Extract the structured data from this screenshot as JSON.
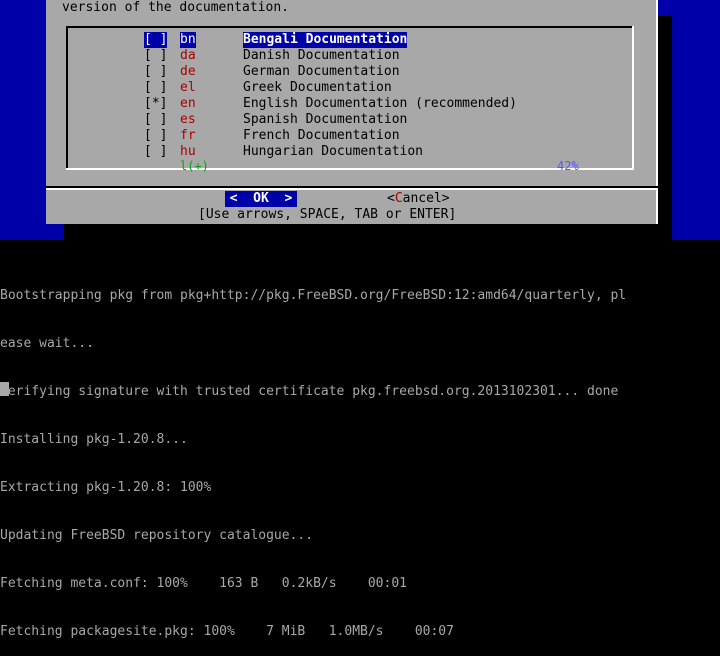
{
  "dialog": {
    "intro_text": "version of the documentation.",
    "items": [
      {
        "checkbox": "[ ]",
        "code": "bn",
        "label": "Bengali Documentation",
        "selected": true
      },
      {
        "checkbox": "[ ]",
        "code": "da",
        "label": "Danish Documentation",
        "selected": false
      },
      {
        "checkbox": "[ ]",
        "code": "de",
        "label": "German Documentation",
        "selected": false
      },
      {
        "checkbox": "[ ]",
        "code": "el",
        "label": "Greek Documentation",
        "selected": false
      },
      {
        "checkbox": "[*]",
        "code": "en",
        "label": "English Documentation (recommended)",
        "selected": false
      },
      {
        "checkbox": "[ ]",
        "code": "es",
        "label": "Spanish Documentation",
        "selected": false
      },
      {
        "checkbox": "[ ]",
        "code": "fr",
        "label": "French Documentation",
        "selected": false
      },
      {
        "checkbox": "[ ]",
        "code": "hu",
        "label": "Hungarian Documentation",
        "selected": false
      }
    ],
    "more_indicator": "l(+)",
    "percent": "42%",
    "ok_label": "<  OK  >",
    "cancel_prefix": "<",
    "cancel_hot": "C",
    "cancel_rest": "ancel>",
    "hint": "[Use arrows, SPACE, TAB or ENTER]"
  },
  "console": {
    "lines": [
      "Bootstrapping pkg from pkg+http://pkg.FreeBSD.org/FreeBSD:12:amd64/quarterly, pl",
      "ease wait...",
      "Verifying signature with trusted certificate pkg.freebsd.org.2013102301... done",
      "Installing pkg-1.20.8...",
      "Extracting pkg-1.20.8: 100%",
      "Updating FreeBSD repository catalogue...",
      "Fetching meta.conf: 100%    163 B   0.2kB/s    00:01",
      "Fetching packagesite.pkg: 100%    7 MiB   1.0MB/s    00:07"
    ]
  },
  "colors": {
    "background_blue": "#0000a8",
    "dialog_gray": "#a8a8a8",
    "selection_blue": "#0000a8",
    "code_red": "#a80000",
    "indicator_green": "#00a800",
    "percent_blue": "#5454fc",
    "console_text": "#a8a8a8"
  }
}
